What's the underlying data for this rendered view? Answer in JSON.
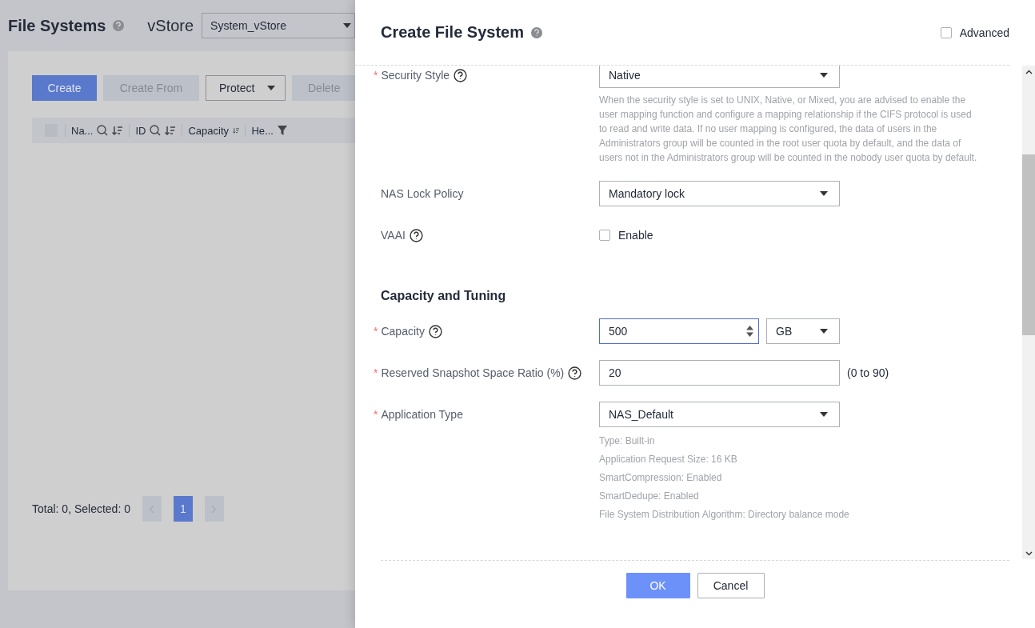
{
  "background_page": {
    "title": "File Systems",
    "vstore_label": "vStore",
    "vstore_value": "System_vStore",
    "toolbar": [
      {
        "label": "Create",
        "kind": "primary"
      },
      {
        "label": "Create From",
        "kind": "disabled"
      },
      {
        "label": "Protect",
        "kind": "dropdown"
      },
      {
        "label": "Delete",
        "kind": "disabled"
      }
    ],
    "table": {
      "select_all_checked": false,
      "columns": [
        {
          "label": "Na...",
          "search": true,
          "sort": true,
          "filter": false
        },
        {
          "label": "ID",
          "search": true,
          "sort": true,
          "filter": false
        },
        {
          "label": "Capacity",
          "search": false,
          "sort": true,
          "filter": false
        },
        {
          "label": "He...",
          "search": false,
          "sort": false,
          "filter": true
        }
      ]
    },
    "pagination": {
      "summary": "Total: 0, Selected: 0",
      "pages": [
        {
          "label": "1",
          "selected": true
        }
      ]
    }
  },
  "dialog": {
    "title": "Create File System",
    "advanced": {
      "label": "Advanced",
      "checked": false
    },
    "fields": [
      {
        "kind": "select",
        "label": "Security Style",
        "required_mark": "*",
        "help": true,
        "value": "Native",
        "notes": [
          "When the security style is set to UNIX, Native, or Mixed, you are advised to enable the user mapping function and configure a mapping relationship if the CIFS protocol is used to read and write data. If no user mapping is configured, the data of users in the Administrators group will be counted in the root user quota by default, and the data of users not in the Administrators group will be counted in the nobody user quota by default."
        ]
      },
      {
        "kind": "select",
        "label": "NAS Lock Policy",
        "help": false,
        "value": "Mandatory lock"
      },
      {
        "kind": "checkbox",
        "label": "VAAI",
        "help": true,
        "option": "Enable",
        "checked": false
      },
      {
        "kind": "heading",
        "label": "Capacity and Tuning"
      },
      {
        "kind": "number",
        "label": "Capacity",
        "required_mark": "*",
        "help": true,
        "value": "500",
        "unit": "GB",
        "focused": true
      },
      {
        "kind": "text",
        "label": "Reserved Snapshot Space Ratio (%)",
        "required_mark": "*",
        "help": true,
        "value": "20",
        "range": "(0 to 90)",
        "focused": false
      },
      {
        "kind": "select",
        "label": "Application Type",
        "required_mark": "*",
        "help": false,
        "value": "NAS_Default",
        "notes": [
          "Type: Built-in",
          "Application Request Size: 16 KB",
          "SmartCompression: Enabled",
          "SmartDedupe: Enabled",
          "File System Distribution Algorithm: Directory balance mode"
        ]
      }
    ],
    "buttons": [
      {
        "label": "OK",
        "kind": "primary"
      },
      {
        "label": "Cancel",
        "kind": "secondary"
      }
    ]
  }
}
